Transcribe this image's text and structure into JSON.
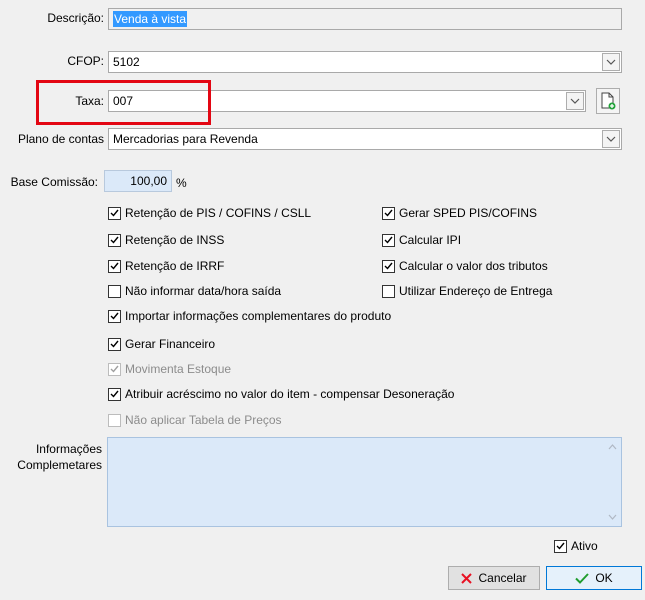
{
  "form": {
    "descricao": {
      "label": "Descrição:",
      "value": "Venda à vista"
    },
    "cfop": {
      "label": "CFOP:",
      "value": "5102"
    },
    "taxa": {
      "label": "Taxa:",
      "value": "007"
    },
    "plano": {
      "label": "Plano de contas",
      "value": "Mercadorias para Revenda"
    },
    "base_comissao": {
      "label": "Base Comissão:",
      "value": "100,00",
      "unit": "%"
    },
    "info": {
      "label_line1": "Informações",
      "label_line2": "Complemetares",
      "value": ""
    }
  },
  "checkboxes_left": [
    {
      "label": "Retenção de PIS / COFINS / CSLL",
      "checked": true
    },
    {
      "label": "Retenção de INSS",
      "checked": true
    },
    {
      "label": "Retenção de IRRF",
      "checked": true
    },
    {
      "label": "Não informar data/hora saída",
      "checked": false
    }
  ],
  "checkboxes_right": [
    {
      "label": "Gerar SPED PIS/COFINS",
      "checked": true
    },
    {
      "label": "Calcular IPI",
      "checked": true
    },
    {
      "label": "Calcular o valor dos tributos",
      "checked": true
    },
    {
      "label": "Utilizar Endereço de Entrega",
      "checked": false
    }
  ],
  "checkboxes_full": [
    {
      "label": "Importar informações complementares do produto",
      "checked": true,
      "disabled": false
    },
    {
      "label": "Gerar Financeiro",
      "checked": true,
      "disabled": false
    },
    {
      "label": "Movimenta Estoque",
      "checked": true,
      "disabled": true
    },
    {
      "label": "Atribuir acréscimo no valor do item - compensar Desoneração",
      "checked": true,
      "disabled": false
    },
    {
      "label": "Não aplicar Tabela de Preços",
      "checked": false,
      "disabled": true
    }
  ],
  "ativo": {
    "label": "Ativo",
    "checked": true
  },
  "buttons": {
    "cancel": "Cancelar",
    "ok": "OK"
  },
  "colors": {
    "accent": "#0078d7",
    "highlight": "#e30613",
    "cancel_icon": "#e81123",
    "ok_icon": "#1f9d2f"
  }
}
